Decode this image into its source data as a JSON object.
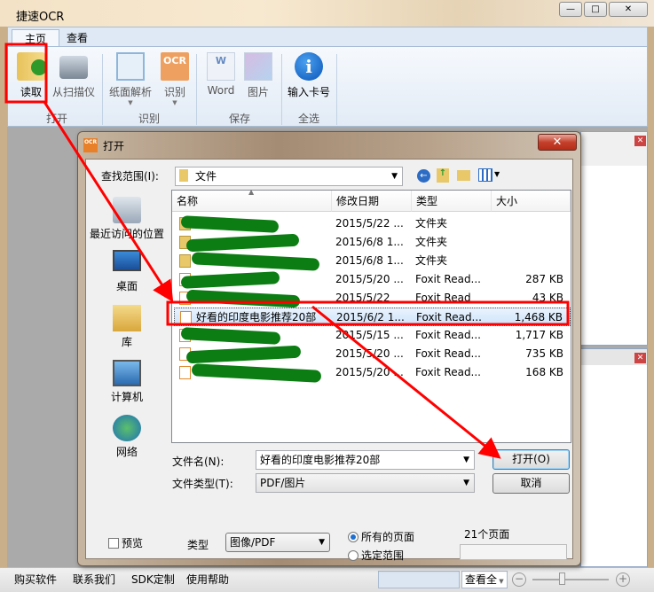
{
  "app": {
    "title": "捷速OCR",
    "window_buttons": [
      "—",
      "□",
      "✕"
    ]
  },
  "ribbon": {
    "tabs": [
      {
        "label": "主页",
        "active": true
      },
      {
        "label": "查看"
      }
    ],
    "buttons": [
      {
        "label": "读取",
        "icon": "folder-open-icon"
      },
      {
        "label": "从扫描仪",
        "icon": "scanner-icon"
      },
      {
        "label": "纸面解析",
        "icon": "layout-analysis-icon"
      },
      {
        "label": "识别",
        "icon": "ocr-icon"
      },
      {
        "label": "Word",
        "icon": "word-icon"
      },
      {
        "label": "图片",
        "icon": "image-icon"
      },
      {
        "label": "输入卡号",
        "icon": "info-icon"
      }
    ],
    "groups": [
      "打开",
      "识别",
      "保存",
      "全选"
    ]
  },
  "dialog": {
    "title": "打开",
    "look_in_label": "查找范围(I):",
    "look_in_value": "文件",
    "places": [
      "最近访问的位置",
      "桌面",
      "库",
      "计算机",
      "网络"
    ],
    "columns": [
      "名称",
      "修改日期",
      "类型",
      "大小"
    ],
    "rows": [
      {
        "name": "",
        "date": "2015/5/22 ...",
        "type": "文件夹",
        "size": "",
        "kind": "folder"
      },
      {
        "name": "",
        "date": "2015/6/8 1...",
        "type": "文件夹",
        "size": "",
        "kind": "folder"
      },
      {
        "name": "",
        "date": "2015/6/8 1...",
        "type": "文件夹",
        "size": "",
        "kind": "folder"
      },
      {
        "name": "",
        "date": "2015/5/20 ...",
        "type": "Foxit Read...",
        "size": "287 KB",
        "kind": "pdf"
      },
      {
        "name": "",
        "date": "2015/5/22",
        "type": "Foxit Read",
        "size": "43 KB",
        "kind": "pdf"
      },
      {
        "name": "好看的印度电影推荐20部",
        "date": "2015/6/2 1...",
        "type": "Foxit Read...",
        "size": "1,468 KB",
        "kind": "pdf",
        "selected": true
      },
      {
        "name": "",
        "date": "2015/5/15 ...",
        "type": "Foxit Read...",
        "size": "1,717 KB",
        "kind": "pdf"
      },
      {
        "name": "",
        "date": "2015/5/20 ...",
        "type": "Foxit Read...",
        "size": "735 KB",
        "kind": "pdf"
      },
      {
        "name": "",
        "date": "2015/5/20 ...",
        "type": "Foxit Read...",
        "size": "168 KB",
        "kind": "pdf"
      }
    ],
    "filename_label": "文件名(N):",
    "filename_value": "好看的印度电影推荐20部",
    "filetype_label": "文件类型(T):",
    "filetype_value": "PDF/图片",
    "open_button": "打开(O)",
    "cancel_button": "取消",
    "preview_label": "预览",
    "type_label": "类型",
    "type_value": "图像/PDF",
    "radio_all": "所有的页面",
    "radio_range": "选定范围",
    "page_count": "21个页面"
  },
  "statusbar": {
    "links": [
      "购买软件",
      "联系我们",
      "SDK定制",
      "使用帮助"
    ],
    "view_select": "查看全"
  },
  "annotation_color": "#ff0000"
}
